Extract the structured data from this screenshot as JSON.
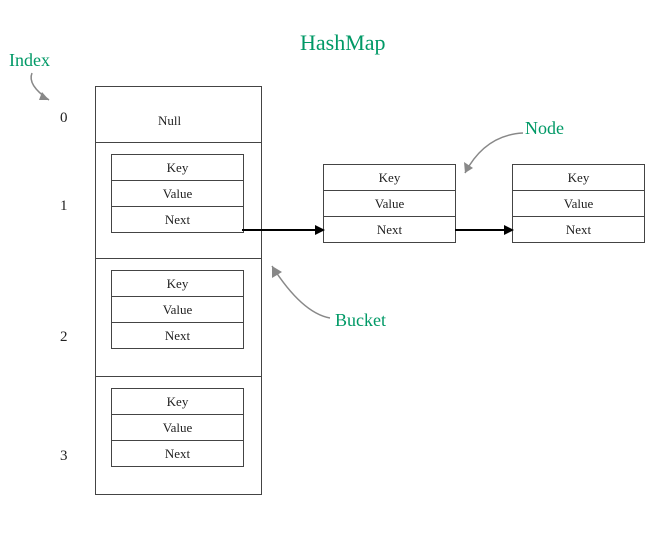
{
  "title": "HashMap",
  "labels": {
    "index": "Index",
    "node": "Node",
    "bucket": "Bucket"
  },
  "indices": [
    "0",
    "1",
    "2",
    "3"
  ],
  "nullText": "Null",
  "nodeRows": {
    "key": "Key",
    "value": "Value",
    "next": "Next"
  }
}
